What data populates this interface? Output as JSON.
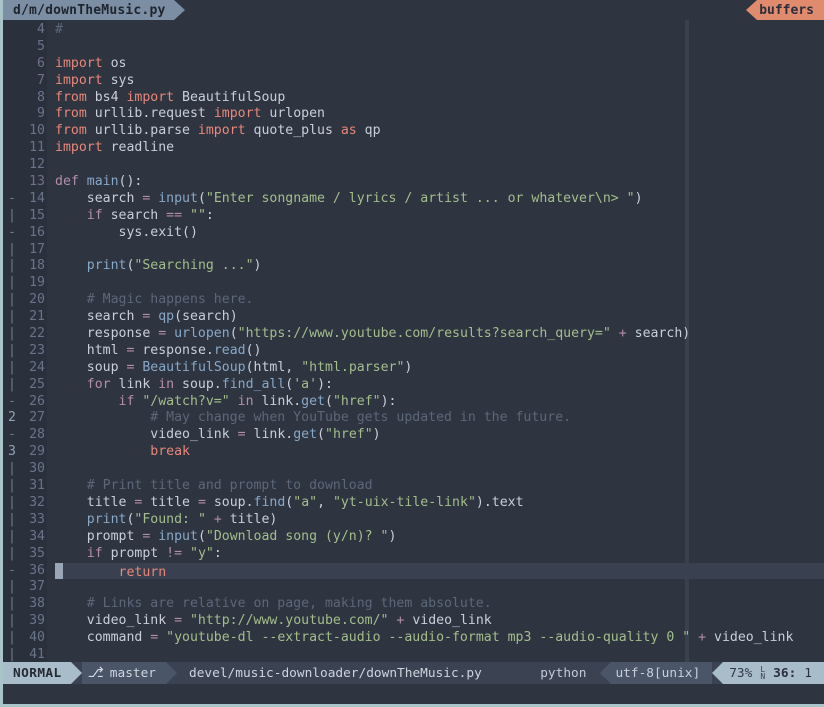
{
  "window": {
    "border_color": "#a8c4c9",
    "background": "#2e3440"
  },
  "tabline": {
    "active_tab": "d/m/downTheMusic.py",
    "buffers_label": "buffers"
  },
  "editor": {
    "colorcolumn": 80,
    "cursor_line": 36,
    "cursor_col": 1,
    "signs": [
      "",
      "",
      "",
      "",
      "",
      "",
      "",
      "",
      "",
      "-",
      "|",
      "-",
      "|",
      "|",
      "|",
      "|",
      "|",
      "|",
      "|",
      "|",
      "|",
      "-",
      "2",
      "-",
      "3",
      "|",
      "|",
      "|",
      "|",
      "|",
      "|",
      "-",
      "|",
      "|",
      "|",
      "|",
      "|",
      "|"
    ],
    "lines": [
      {
        "num": 4,
        "sign": "",
        "tokens": [
          [
            "cmt",
            "#"
          ]
        ]
      },
      {
        "num": 5,
        "sign": "",
        "tokens": []
      },
      {
        "num": 6,
        "sign": "",
        "tokens": [
          [
            "kw",
            "import"
          ],
          [
            "id",
            " os"
          ]
        ]
      },
      {
        "num": 7,
        "sign": "",
        "tokens": [
          [
            "kw",
            "import"
          ],
          [
            "id",
            " sys"
          ]
        ]
      },
      {
        "num": 8,
        "sign": "",
        "tokens": [
          [
            "kw",
            "from"
          ],
          [
            "id",
            " bs4 "
          ],
          [
            "kw",
            "import"
          ],
          [
            "id",
            " BeautifulSoup"
          ]
        ]
      },
      {
        "num": 9,
        "sign": "",
        "tokens": [
          [
            "kw",
            "from"
          ],
          [
            "id",
            " urllib.request "
          ],
          [
            "kw",
            "import"
          ],
          [
            "id",
            " urlopen"
          ]
        ]
      },
      {
        "num": 10,
        "sign": "",
        "tokens": [
          [
            "kw",
            "from"
          ],
          [
            "id",
            " urllib.parse "
          ],
          [
            "kw",
            "import"
          ],
          [
            "id",
            " quote_plus "
          ],
          [
            "kw",
            "as"
          ],
          [
            "id",
            " qp"
          ]
        ]
      },
      {
        "num": 11,
        "sign": "",
        "tokens": [
          [
            "kw",
            "import"
          ],
          [
            "id",
            " readline"
          ]
        ]
      },
      {
        "num": 12,
        "sign": "",
        "tokens": []
      },
      {
        "num": 13,
        "sign": "",
        "tokens": [
          [
            "kw2",
            "def"
          ],
          [
            "fn",
            " main"
          ],
          [
            "pn",
            "():"
          ]
        ]
      },
      {
        "num": 14,
        "sign": "-",
        "tokens": [
          [
            "id",
            "    search "
          ],
          [
            "op",
            "="
          ],
          [
            "fn",
            " input"
          ],
          [
            "pn",
            "("
          ],
          [
            "str",
            "\"Enter songname / lyrics / artist ... or whatever\\n> \""
          ],
          [
            "pn",
            ")"
          ]
        ]
      },
      {
        "num": 15,
        "sign": "|",
        "tokens": [
          [
            "kw2",
            "    if"
          ],
          [
            "id",
            " search "
          ],
          [
            "op",
            "=="
          ],
          [
            "str",
            " \"\""
          ],
          [
            "pn",
            ":"
          ]
        ]
      },
      {
        "num": 16,
        "sign": "-",
        "tokens": [
          [
            "id",
            "        sys.exit"
          ],
          [
            "pn",
            "()"
          ]
        ]
      },
      {
        "num": 17,
        "sign": "|",
        "tokens": []
      },
      {
        "num": 18,
        "sign": "|",
        "tokens": [
          [
            "fn",
            "    print"
          ],
          [
            "pn",
            "("
          ],
          [
            "str",
            "\"Searching ...\""
          ],
          [
            "pn",
            ")"
          ]
        ]
      },
      {
        "num": 19,
        "sign": "|",
        "tokens": []
      },
      {
        "num": 20,
        "sign": "|",
        "tokens": [
          [
            "cmt",
            "    # Magic happens here."
          ]
        ]
      },
      {
        "num": 21,
        "sign": "|",
        "tokens": [
          [
            "id",
            "    search "
          ],
          [
            "op",
            "="
          ],
          [
            "fn",
            " qp"
          ],
          [
            "pn",
            "("
          ],
          [
            "id",
            "search"
          ],
          [
            "pn",
            ")"
          ]
        ]
      },
      {
        "num": 22,
        "sign": "|",
        "tokens": [
          [
            "id",
            "    response "
          ],
          [
            "op",
            "="
          ],
          [
            "fn",
            " urlopen"
          ],
          [
            "pn",
            "("
          ],
          [
            "str",
            "\"https://www.youtube.com/results?search_query=\""
          ],
          [
            "op",
            " +"
          ],
          [
            "id",
            " search"
          ],
          [
            "pn",
            ")"
          ]
        ]
      },
      {
        "num": 23,
        "sign": "|",
        "tokens": [
          [
            "id",
            "    html "
          ],
          [
            "op",
            "="
          ],
          [
            "id",
            " response."
          ],
          [
            "fn",
            "read"
          ],
          [
            "pn",
            "()"
          ]
        ]
      },
      {
        "num": 24,
        "sign": "|",
        "tokens": [
          [
            "id",
            "    soup "
          ],
          [
            "op",
            "="
          ],
          [
            "fn",
            " BeautifulSoup"
          ],
          [
            "pn",
            "("
          ],
          [
            "id",
            "html"
          ],
          [
            "pn",
            ", "
          ],
          [
            "str",
            "\"html.parser\""
          ],
          [
            "pn",
            ")"
          ]
        ]
      },
      {
        "num": 25,
        "sign": "|",
        "tokens": [
          [
            "kw2",
            "    for"
          ],
          [
            "id",
            " link "
          ],
          [
            "kw2",
            "in"
          ],
          [
            "id",
            " soup."
          ],
          [
            "fn",
            "find_all"
          ],
          [
            "pn",
            "("
          ],
          [
            "str",
            "'a'"
          ],
          [
            "pn",
            "):"
          ]
        ]
      },
      {
        "num": 26,
        "sign": "-",
        "tokens": [
          [
            "kw2",
            "        if"
          ],
          [
            "str",
            " \"/watch?v=\""
          ],
          [
            "kw2",
            " in"
          ],
          [
            "id",
            " link."
          ],
          [
            "fn",
            "get"
          ],
          [
            "pn",
            "("
          ],
          [
            "str",
            "\"href\""
          ],
          [
            "pn",
            "):"
          ]
        ]
      },
      {
        "num": 27,
        "sign": "2",
        "tokens": [
          [
            "cmt",
            "            # May change when YouTube gets updated in the future."
          ]
        ]
      },
      {
        "num": 28,
        "sign": "-",
        "tokens": [
          [
            "id",
            "            video_link "
          ],
          [
            "op",
            "="
          ],
          [
            "id",
            " link."
          ],
          [
            "fn",
            "get"
          ],
          [
            "pn",
            "("
          ],
          [
            "str",
            "\"href\""
          ],
          [
            "pn",
            ")"
          ]
        ]
      },
      {
        "num": 29,
        "sign": "3",
        "tokens": [
          [
            "kw",
            "            break"
          ]
        ]
      },
      {
        "num": 30,
        "sign": "|",
        "tokens": []
      },
      {
        "num": 31,
        "sign": "|",
        "tokens": [
          [
            "cmt",
            "    # Print title and prompt to download"
          ]
        ]
      },
      {
        "num": 32,
        "sign": "|",
        "tokens": [
          [
            "id",
            "    title "
          ],
          [
            "op",
            "="
          ],
          [
            "id",
            " title "
          ],
          [
            "op",
            "="
          ],
          [
            "id",
            " soup."
          ],
          [
            "fn",
            "find"
          ],
          [
            "pn",
            "("
          ],
          [
            "str",
            "\"a\""
          ],
          [
            "pn",
            ", "
          ],
          [
            "str",
            "\"yt-uix-tile-link\""
          ],
          [
            "pn",
            ")"
          ],
          [
            "id",
            ".text"
          ]
        ]
      },
      {
        "num": 33,
        "sign": "|",
        "tokens": [
          [
            "fn",
            "    print"
          ],
          [
            "pn",
            "("
          ],
          [
            "str",
            "\"Found: \""
          ],
          [
            "op",
            " +"
          ],
          [
            "id",
            " title"
          ],
          [
            "pn",
            ")"
          ]
        ]
      },
      {
        "num": 34,
        "sign": "|",
        "tokens": [
          [
            "id",
            "    prompt "
          ],
          [
            "op",
            "="
          ],
          [
            "fn",
            " input"
          ],
          [
            "pn",
            "("
          ],
          [
            "str",
            "\"Download song (y/n)? \""
          ],
          [
            "pn",
            ")"
          ]
        ]
      },
      {
        "num": 35,
        "sign": "|",
        "tokens": [
          [
            "kw2",
            "    if"
          ],
          [
            "id",
            " prompt "
          ],
          [
            "op",
            "!="
          ],
          [
            "str",
            " \"y\""
          ],
          [
            "pn",
            ":"
          ]
        ]
      },
      {
        "num": 36,
        "sign": "-",
        "tokens": [
          [
            "kw",
            "        return"
          ]
        ],
        "cursor": true
      },
      {
        "num": 37,
        "sign": "|",
        "tokens": []
      },
      {
        "num": 38,
        "sign": "|",
        "tokens": [
          [
            "cmt",
            "    # Links are relative on page, making them absolute."
          ]
        ]
      },
      {
        "num": 39,
        "sign": "|",
        "tokens": [
          [
            "id",
            "    video_link "
          ],
          [
            "op",
            "="
          ],
          [
            "str",
            " \"http://www.youtube.com/\""
          ],
          [
            "op",
            " +"
          ],
          [
            "id",
            " video_link"
          ]
        ]
      },
      {
        "num": 40,
        "sign": "|",
        "tokens": [
          [
            "id",
            "    command "
          ],
          [
            "op",
            "="
          ],
          [
            "str",
            " \"youtube-dl --extract-audio --audio-format mp3 --audio-quality 0 \""
          ],
          [
            "op",
            " +"
          ],
          [
            "id",
            " video_link"
          ]
        ]
      },
      {
        "num": 41,
        "sign": "|",
        "tokens": []
      }
    ]
  },
  "statusline": {
    "mode": "NORMAL",
    "branch_icon": "branch-icon",
    "branch": "master",
    "file": "devel/music-downloader/downTheMusic.py",
    "filetype": "python",
    "encoding": "utf-8[unix]",
    "percent": "73%",
    "line_glyph_top": "L",
    "line_glyph_bottom": "N",
    "line": "36:",
    "column": "1"
  },
  "colors": {
    "bg": "#2e3440",
    "gutter_bg": "#2b313c",
    "accent_orange": "#e08a6e",
    "accent_blue_gray": "#7b8ea3",
    "mode_bg": "#a8bcc9",
    "string": "#a3be8c",
    "keyword": "#e8877a",
    "keyword2": "#b48ead",
    "function": "#88a8c8",
    "comment": "#5c6779",
    "cursorline": "#394150",
    "border": "#a8c4c9"
  }
}
